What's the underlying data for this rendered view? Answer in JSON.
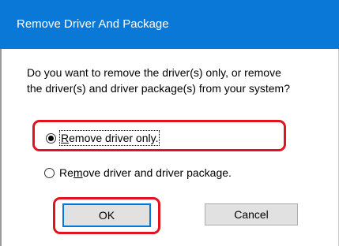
{
  "dialog": {
    "title": "Remove Driver And Package",
    "message_line1": "Do you want to remove the driver(s) only, or remove",
    "message_line2": "the driver(s) and driver package(s) from your system?"
  },
  "options": [
    {
      "label_prefix": "",
      "label_mnemonic": "R",
      "label_rest": "emove driver only.",
      "checked": true
    },
    {
      "label_prefix": "Re",
      "label_mnemonic": "m",
      "label_rest": "ove driver and driver package.",
      "checked": false
    }
  ],
  "buttons": {
    "ok_label": "OK",
    "cancel_label": "Cancel"
  },
  "colors": {
    "titlebar": "#0a78d7",
    "highlight": "#e0141e"
  }
}
